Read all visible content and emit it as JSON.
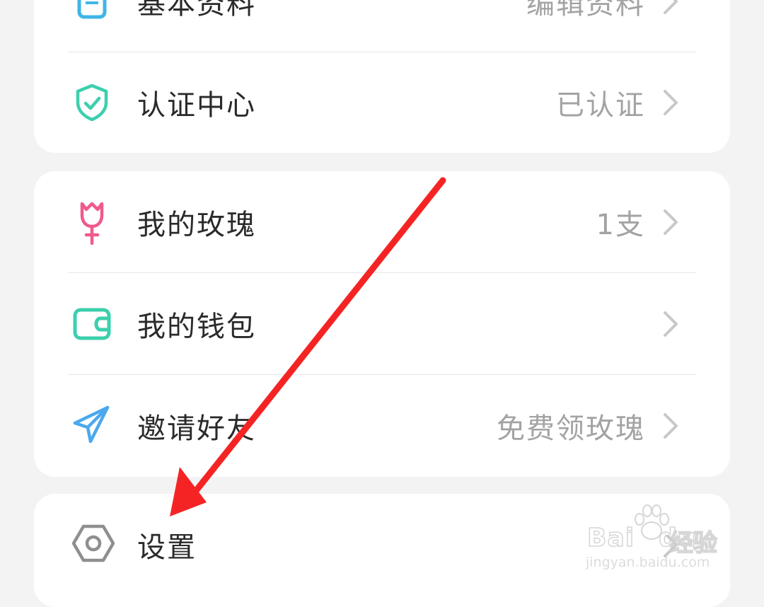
{
  "sections": [
    {
      "rows": [
        {
          "icon": "document-icon",
          "label": "基本资料",
          "value": "编辑资料"
        },
        {
          "icon": "shield-check-icon",
          "label": "认证中心",
          "value": "已认证"
        }
      ]
    },
    {
      "rows": [
        {
          "icon": "rose-icon",
          "label": "我的玫瑰",
          "value": "1支"
        },
        {
          "icon": "wallet-icon",
          "label": "我的钱包",
          "value": ""
        },
        {
          "icon": "paper-plane-icon",
          "label": "邀请好友",
          "value": "免费领玫瑰"
        }
      ]
    },
    {
      "rows": [
        {
          "icon": "gear-hexagon-icon",
          "label": "设置",
          "value": ""
        }
      ]
    }
  ],
  "colors": {
    "teal": "#3ccfad",
    "pink": "#ef5a8c",
    "blue": "#4aa8ee",
    "gray_icon": "#8f8f8f",
    "arrow_red": "#f52424"
  },
  "watermark": {
    "brand": "Bai",
    "brand_suffix": "du",
    "product": "经验",
    "url": "jingyan.baidu.com"
  }
}
